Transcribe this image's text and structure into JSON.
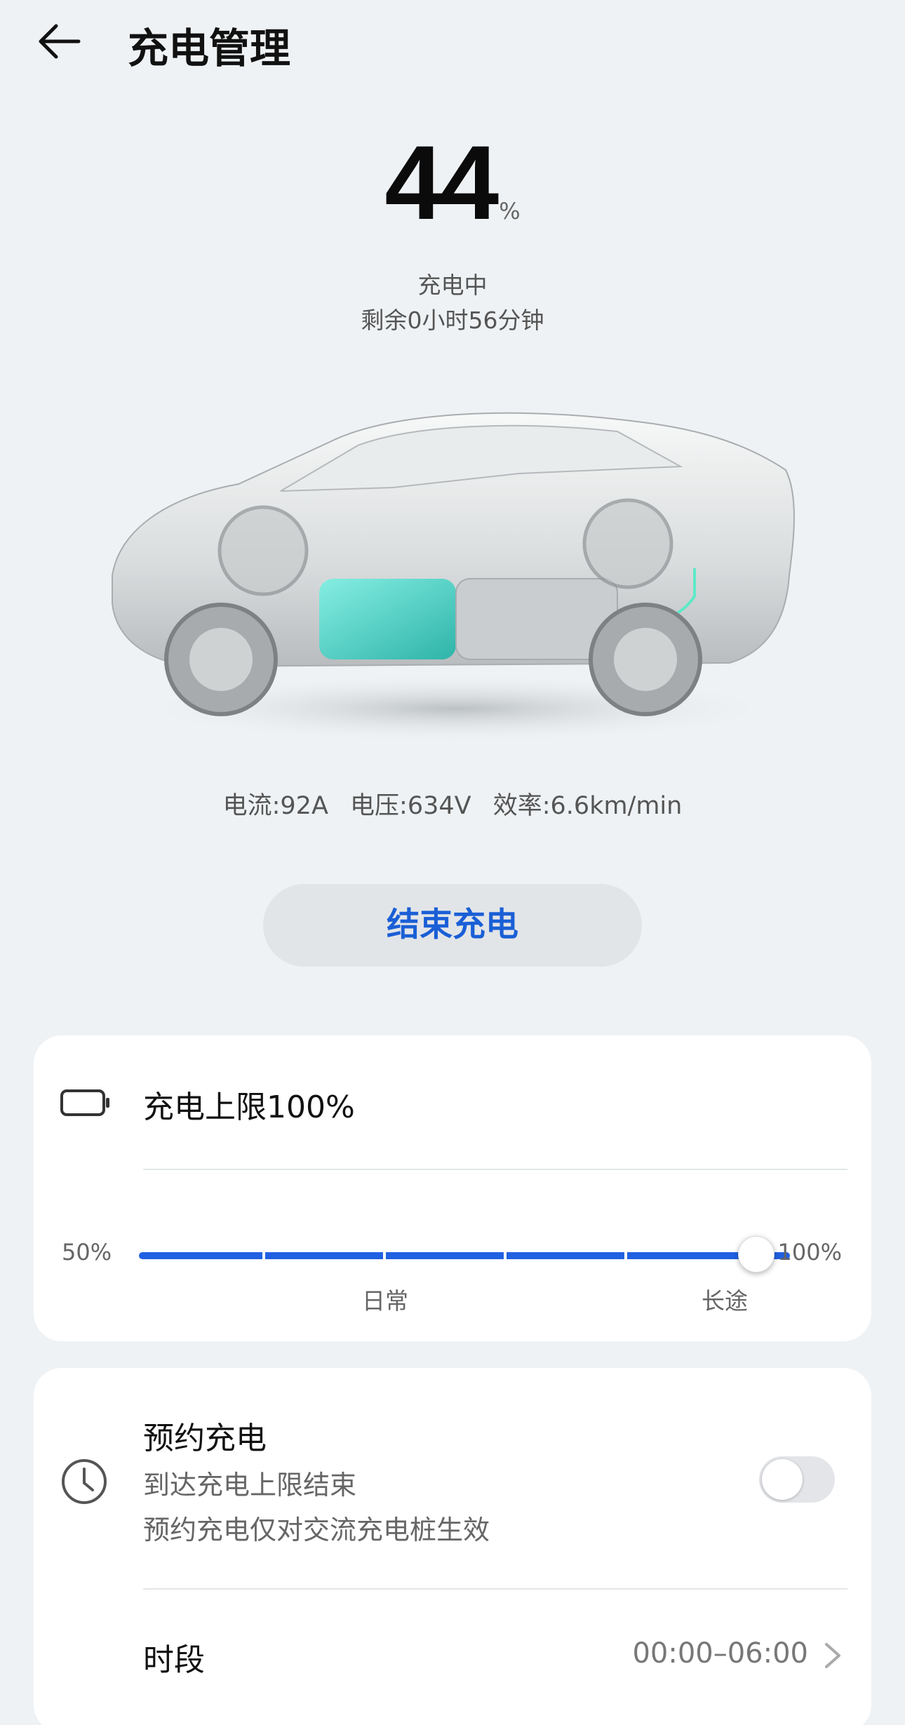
{
  "header": {
    "title": "充电管理"
  },
  "battery": {
    "percent": "44",
    "unit": "%",
    "status": "充电中",
    "remaining": "剩余0小时56分钟",
    "charged_fraction": 0.44
  },
  "metrics": {
    "current": "电流:92A",
    "voltage": "电压:634V",
    "efficiency": "效率:6.6km/min"
  },
  "actions": {
    "end_charging": "结束充电"
  },
  "charge_limit": {
    "title": "充电上限100%",
    "min_label": "50%",
    "max_label": "100%",
    "value_percent": 100,
    "marks": [
      "日常",
      "长途"
    ]
  },
  "schedule": {
    "title": "预约充电",
    "subtitle1": "到达充电上限结束",
    "subtitle2": "预约充电仅对交流充电桩生效",
    "enabled": false,
    "period_label": "时段",
    "period_value": "00:00–06:00"
  },
  "colors": {
    "accent": "#1a5fd6",
    "slider": "#2061e2",
    "background": "#eff2f4",
    "battery_glow": "#3fd3c5"
  },
  "icons": [
    "back-arrow-icon",
    "battery-icon",
    "clock-icon",
    "chevron-right-icon"
  ]
}
